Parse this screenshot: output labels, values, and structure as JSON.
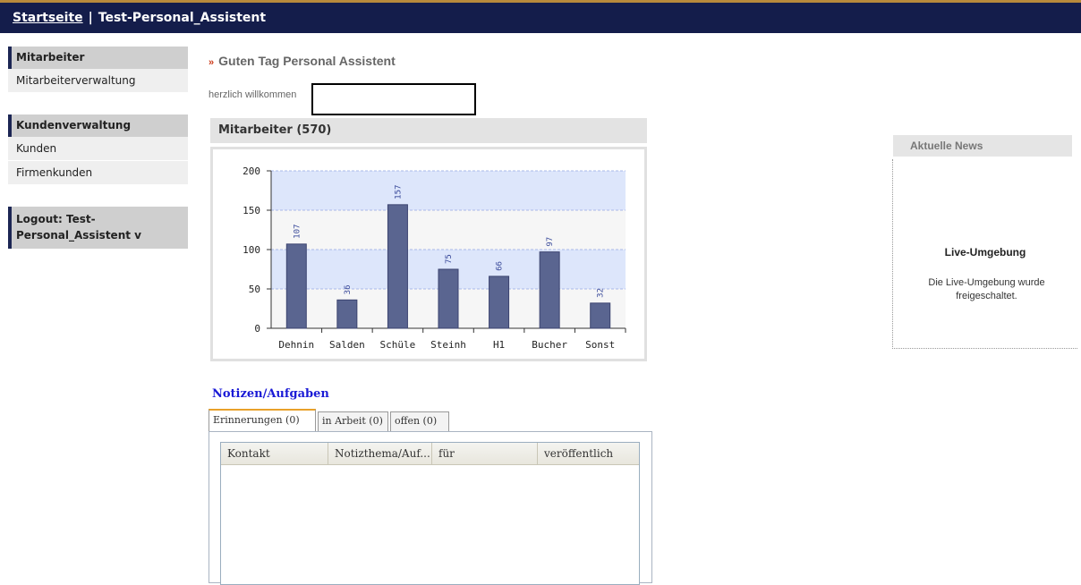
{
  "header": {
    "home_link": "Startseite",
    "separator": "|",
    "title": "Test-Personal_Assistent"
  },
  "sidebar": {
    "groups": [
      {
        "title": "Mitarbeiter",
        "items": [
          "Mitarbeiterverwaltung"
        ]
      },
      {
        "title": "Kundenverwaltung",
        "items": [
          "Kunden",
          "Firmenkunden"
        ]
      }
    ],
    "logout": "Logout: Test-Personal_Assistent v"
  },
  "main": {
    "greeting": "Guten Tag Personal Assistent",
    "welcome": "herzlich willkommen",
    "panel_title": "Mitarbeiter (570)"
  },
  "chart_data": {
    "type": "bar",
    "categories": [
      "Dehnin",
      "Salden",
      "Schüle",
      "Steinh",
      "H1",
      "Bucher",
      "Sonst"
    ],
    "values": [
      107,
      36,
      157,
      75,
      66,
      97,
      32
    ],
    "ylim": [
      0,
      200
    ],
    "yticks": [
      0,
      50,
      100,
      150,
      200
    ],
    "grid": true,
    "bar_color": "#5a6590",
    "band_colors": [
      "#f6f6f6",
      "#dde6fb"
    ]
  },
  "news": {
    "header": "Aktuelle News",
    "title": "Live-Umgebung",
    "text": "Die Live-Umgebung wurde freigeschaltet."
  },
  "notes": {
    "title": "Notizen/Aufgaben",
    "tabs": [
      "Erinnerungen (0)",
      "in Arbeit (0)",
      "offen (0)"
    ],
    "columns": [
      "Kontakt",
      "Notizthema/Auf...",
      "für",
      "veröffentlich"
    ]
  },
  "colors": {
    "topbar": "#141d4b",
    "accent": "#b88a3c",
    "link_blue": "#1a1ad6"
  }
}
